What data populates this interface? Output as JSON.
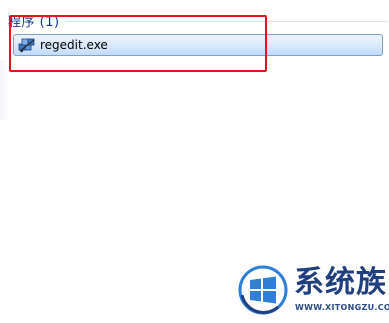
{
  "section": {
    "title": "程序 (1)"
  },
  "results": [
    {
      "label": "regedit.exe",
      "icon": "regedit-icon",
      "selected": true
    }
  ],
  "annotation": {
    "color": "#e8121d"
  },
  "watermark": {
    "title": "系统族",
    "url": "WWW.XITONGZU.COM",
    "logo": "windows-logo-icon"
  },
  "colors": {
    "section_title": "#1e3287",
    "selection_border": "#7da2ce",
    "watermark": "#1f3f7f"
  }
}
